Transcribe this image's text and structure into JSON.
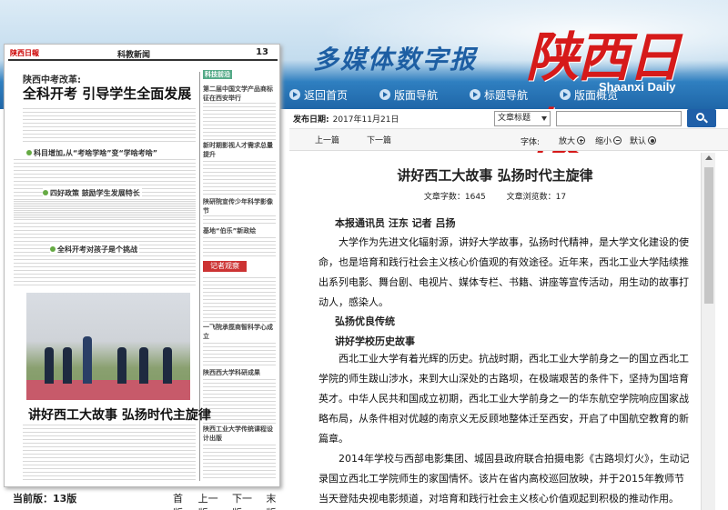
{
  "header": {
    "site_title": "多媒体数字报",
    "logo_text": "陕西日報",
    "logo_en": "Shaanxi Daily",
    "nav": [
      {
        "label": "返回首页",
        "icon": "arrow-right-icon"
      },
      {
        "label": "版面导航",
        "icon": "arrow-right-icon"
      },
      {
        "label": "标题导航",
        "icon": "arrow-right-icon"
      },
      {
        "label": "版面概览",
        "icon": "arrow-right-icon"
      }
    ]
  },
  "paper": {
    "masthead_logo": "陕西日報",
    "section": "科教新闻",
    "page_number": "13",
    "kicker": "陕西中考改革:",
    "headline": "全科开考  引导学生全面发展",
    "subheads": [
      "科目增加,从“考啥学啥”变“学啥考啥”",
      "四好政策 鼓励学生发展特长",
      "全科开考对孩子是个挑战"
    ],
    "right_titles": [
      "科技前沿",
      "第二届中国文学产品商标征在西安举行",
      "新时期影视人才需求总量提升",
      "陕研院宣传少年科学影像节",
      "基地“伯乐”新政绘",
      "一飞院承揽商智科学心成立",
      "陕西西大学科研成果",
      "陕西工业大学传统课程设计出版"
    ],
    "tag_right": "记者观察",
    "bottom_headline": "讲好西工大故事  弘扬时代主旋律"
  },
  "page_status": {
    "current_label": "当前版：13版",
    "nav": [
      "首版",
      "上一版",
      "下一版",
      "末版"
    ]
  },
  "search": {
    "date_label": "发布日期:",
    "date_value": "2017年11月21日",
    "select_value": "文章标题",
    "input_value": "",
    "button_icon": "search-icon"
  },
  "toolbar": {
    "prev": "上一篇",
    "next": "下一篇",
    "font_label": "字体:",
    "zoom_in": "放大",
    "zoom_out": "缩小",
    "default": "默认"
  },
  "article": {
    "title": "讲好西工大故事  弘扬时代主旋律",
    "word_count": "文章字数：1645",
    "view_count": "文章浏览数：17",
    "byline": "本报通讯员  汪东  记者  吕扬",
    "para1": "大学作为先进文化辐射源，讲好大学故事，弘扬时代精神，是大学文化建设的使命，也是培育和践行社会主义核心价值观的有效途径。近年来，西北工业大学陆续推出系列电影、舞台剧、电视片、媒体专栏、书籍、讲座等宣传活动，用生动的故事打动人，感染人。",
    "subhead1": "弘扬优良传统",
    "subhead2": "讲好学校历史故事",
    "para2": "西北工业大学有着光辉的历史。抗战时期，西北工业大学前身之一的国立西北工学院的师生跋山涉水，来到大山深处的古路坝，在极端艰苦的条件下，坚持为国培育英才。中华人民共和国成立初期，西北工业大学前身之一的华东航空学院响应国家战略布局，从条件相对优越的南京义无反顾地整体迁至西安，开启了中国航空教育的新篇章。",
    "para3": "2014年学校与西部电影集团、城固县政府联合拍摄电影《古路坝灯火》，生动记录国立西北工学院师生的家国情怀。该片在省内高校巡回放映，并于2015年教师节当天登陆央视电影频道，对培育和践行社会主义核心价值观起到积极的推动作用。"
  },
  "colors": {
    "brand_blue": "#1f66a8",
    "logo_red": "#d61a1a"
  }
}
